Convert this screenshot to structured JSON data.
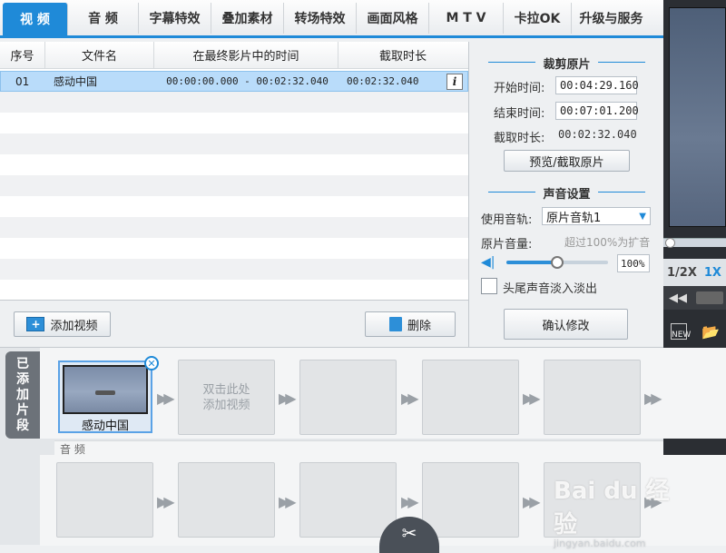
{
  "tabs": [
    {
      "label": "视 频",
      "active": true
    },
    {
      "label": "音 频",
      "active": false
    },
    {
      "label": "字幕特效",
      "active": false
    },
    {
      "label": "叠加素材",
      "active": false
    },
    {
      "label": "转场特效",
      "active": false
    },
    {
      "label": "画面风格",
      "active": false
    },
    {
      "label": "M T V",
      "active": false
    },
    {
      "label": "卡拉OK",
      "active": false
    },
    {
      "label": "升级与服务",
      "active": false
    }
  ],
  "table": {
    "headers": [
      "序号",
      "文件名",
      "在最终影片中的时间",
      "截取时长"
    ],
    "rows": [
      {
        "index": "01",
        "name": "感动中国",
        "range": "00:00:00.000 - 00:02:32.040",
        "duration": "00:02:32.040",
        "info_icon": "i"
      }
    ]
  },
  "actions": {
    "add_video": "添加视频",
    "delete": "删除"
  },
  "clip_panel": {
    "title": "裁剪原片",
    "start_label": "开始时间:",
    "start_value": "00:04:29.160",
    "end_label": "结束时间:",
    "end_value": "00:07:01.200",
    "dur_label": "截取时长:",
    "dur_value": "00:02:32.040",
    "preview_button": "预览/截取原片"
  },
  "audio_panel": {
    "title": "声音设置",
    "track_label": "使用音轨:",
    "track_value": "原片音轨1",
    "volume_label": "原片音量:",
    "volume_hint": "超过100%为扩音",
    "volume_value": "100%",
    "volume_level": 0.5,
    "fade_label": "头尾声音淡入淡出",
    "confirm_button": "确认修改"
  },
  "preview": {
    "speed_half": "1/2X",
    "speed_one": "1X",
    "new_label": "NEW"
  },
  "timeline": {
    "side_label": [
      "已",
      "添",
      "加",
      "片",
      "段"
    ],
    "clip_label": "感动中国",
    "empty_slot_hint": [
      "双击此处",
      "添加视频"
    ],
    "audio_label": "音 频"
  },
  "watermark": {
    "main": "Bai du 经验",
    "sub": "jingyan.baidu.com"
  }
}
